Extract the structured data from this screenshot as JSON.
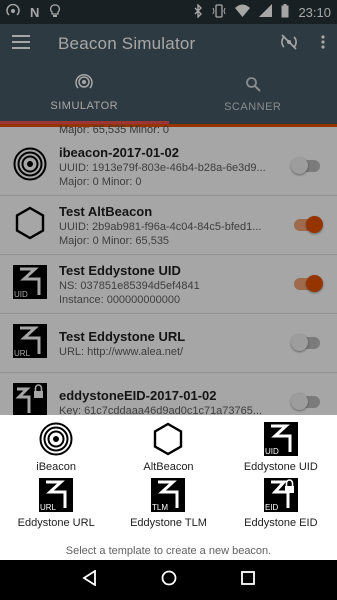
{
  "status_bar": {
    "time": "23:10"
  },
  "app_bar": {
    "title": "Beacon Simulator"
  },
  "tabs": [
    {
      "label": "SIMULATOR",
      "active": true
    },
    {
      "label": "SCANNER",
      "active": false
    }
  ],
  "partial_row": {
    "detail": "Major: 65,535 Minor: 0"
  },
  "beacons": [
    {
      "name": "ibeacon-2017-01-02",
      "line1": "UUID: 1913e79f-803e-46b4-b28a-6e3d9...",
      "line2": "Major: 0 Minor: 0",
      "icon": "ibeacon-icon",
      "enabled": false
    },
    {
      "name": "Test AltBeacon",
      "line1": "UUID: 2b9ab981-f96a-4c04-84c5-bfed1...",
      "line2": "Major: 0 Minor: 65,535",
      "icon": "altbeacon-icon",
      "enabled": true
    },
    {
      "name": "Test Eddystone UID",
      "line1": "NS: 037851e85394d5ef4841",
      "line2": "Instance: 000000000000",
      "icon": "eddystone-uid-icon",
      "enabled": true
    },
    {
      "name": "Test Eddystone URL",
      "line1": "URL: http://www.alea.net/",
      "line2": "",
      "icon": "eddystone-url-icon",
      "enabled": false
    },
    {
      "name": "eddystoneEID-2017-01-02",
      "line1": "Key: 61c7cddaaa46d9ad0c1c71a73765...",
      "line2": "",
      "icon": "eddystone-eid-icon",
      "enabled": false
    }
  ],
  "sheet": {
    "templates": [
      {
        "label": "iBeacon",
        "icon": "ibeacon-icon"
      },
      {
        "label": "AltBeacon",
        "icon": "altbeacon-icon"
      },
      {
        "label": "Eddystone UID",
        "icon": "eddystone-uid-icon",
        "badge": "UID"
      },
      {
        "label": "Eddystone URL",
        "icon": "eddystone-url-icon",
        "badge": "URL"
      },
      {
        "label": "Eddystone TLM",
        "icon": "eddystone-tlm-icon",
        "badge": "TLM"
      },
      {
        "label": "Eddystone EID",
        "icon": "eddystone-eid-icon",
        "badge": "EID"
      }
    ],
    "hint": "Select a template to create a new beacon."
  },
  "colors": {
    "accent": "#e65100",
    "app_bar": "#455a64",
    "status_bar": "#263238"
  }
}
